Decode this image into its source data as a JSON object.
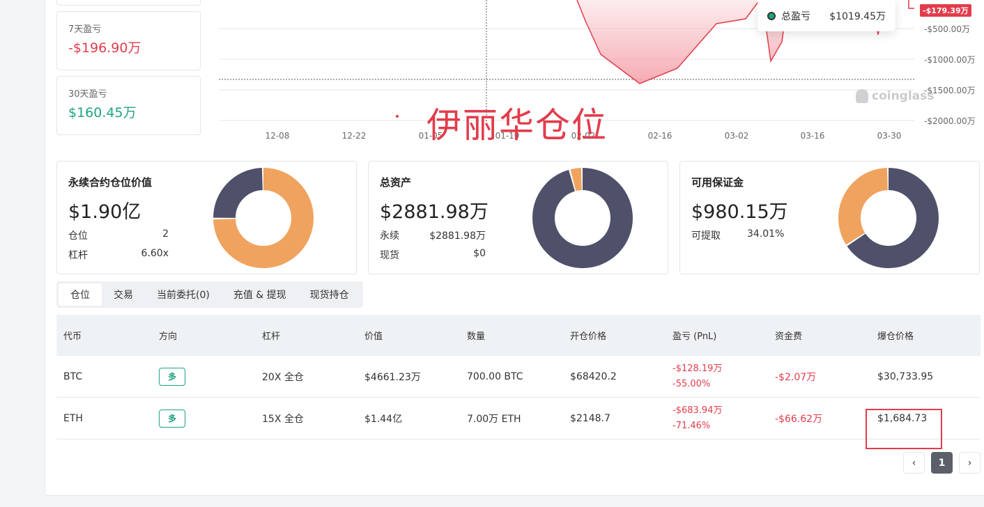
{
  "stats": {
    "pnl7": {
      "label": "7天盈亏",
      "value": "-$196.90万"
    },
    "pnl30": {
      "label": "30天盈亏",
      "value": "$160.45万"
    }
  },
  "chart": {
    "y_labels": [
      "-$500.00万",
      "-$1000.00万",
      "-$1500.00万",
      "-$2000.00万"
    ],
    "x_labels": [
      "12-08",
      "12-22",
      "01-05",
      "01-19",
      "02-02",
      "02-16",
      "03-02",
      "03-16",
      "03-30"
    ],
    "tooltip": {
      "label": "总盈亏",
      "value": "$1019.45万"
    },
    "price_tag": "-$179.39万",
    "watermark": "coinglass",
    "overlay_text": "伊丽华仓位",
    "colors": {
      "loss_fill": "#f4a3ab",
      "loss_line": "#e23c4b"
    }
  },
  "chart_data": {
    "type": "area",
    "x": [
      "12-08",
      "12-22",
      "01-05",
      "01-19",
      "02-02",
      "02-16",
      "03-02",
      "03-16",
      "03-30"
    ],
    "ylim": [
      -2000,
      0
    ],
    "y_unit": "万",
    "title": ""
  },
  "cards": {
    "perp": {
      "title": "永续合约仓位价值",
      "value": "$1.90亿",
      "rows": [
        {
          "k": "仓位",
          "v": "2"
        },
        {
          "k": "杠杆",
          "v": "6.60x"
        }
      ],
      "donut": [
        {
          "name": "a",
          "value": 75,
          "color": "#f0a35e"
        },
        {
          "name": "b",
          "value": 25,
          "color": "#4f516b"
        }
      ]
    },
    "assets": {
      "title": "总资产",
      "value": "$2881.98万",
      "rows": [
        {
          "k": "永续",
          "v": "$2881.98万"
        },
        {
          "k": "现货",
          "v": "$0"
        }
      ],
      "donut": [
        {
          "name": "a",
          "value": 96,
          "color": "#4f516b"
        },
        {
          "name": "b",
          "value": 4,
          "color": "#f0a35e"
        }
      ]
    },
    "margin": {
      "title": "可用保证金",
      "value": "$980.15万",
      "rows": [
        {
          "k": "可提取",
          "v": "34.01%"
        }
      ],
      "donut": [
        {
          "name": "a",
          "value": 66,
          "color": "#4f516b"
        },
        {
          "name": "b",
          "value": 34,
          "color": "#f0a35e"
        }
      ]
    }
  },
  "tabs": [
    "仓位",
    "交易",
    "当前委托(0)",
    "充值 & 提现",
    "现货持仓"
  ],
  "table": {
    "headers": [
      "代币",
      "方向",
      "杠杆",
      "价值",
      "数量",
      "开仓价格",
      "盈亏 (PnL)",
      "资金费",
      "爆仓价格"
    ],
    "rows": [
      {
        "coin": "BTC",
        "dir": "多",
        "lev": "20X 全仓",
        "value": "$4661.23万",
        "qty": "700.00 BTC",
        "entry": "$68420.2",
        "pnl": "-$128.19万",
        "pnl_pct": "-55.00%",
        "funding": "-$2.07万",
        "liq": "$30,733.95"
      },
      {
        "coin": "ETH",
        "dir": "多",
        "lev": "15X 全仓",
        "value": "$1.44亿",
        "qty": "7.00万 ETH",
        "entry": "$2148.7",
        "pnl": "-$683.94万",
        "pnl_pct": "-71.46%",
        "funding": "-$66.62万",
        "liq": "$1,684.73"
      }
    ]
  },
  "pagination": {
    "prev": "‹",
    "page": "1",
    "next": "›"
  }
}
